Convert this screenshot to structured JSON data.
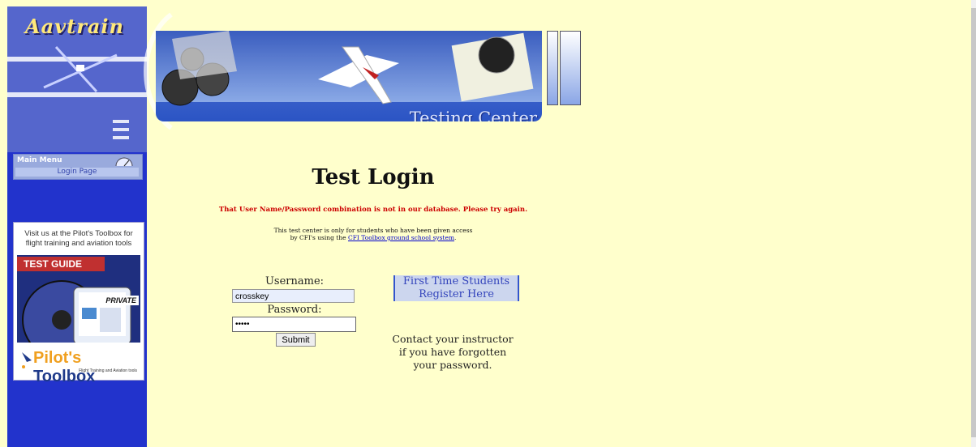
{
  "sidebar": {
    "logo_text": "Aavtrain",
    "menu_title": "Main Menu",
    "menu_item": "Login Page",
    "promo_text": "Visit us at the Pilot's Toolbox for flight training and aviation tools",
    "promo_cover": "TEST GUIDE",
    "promo_private": "PRIVATE",
    "toolbox_name_1": "Pilot's ",
    "toolbox_name_2": "Toolbox",
    "toolbox_tag": "Flight Training and Aviation tools"
  },
  "banner": {
    "title": "Testing Center"
  },
  "main": {
    "title": "Test Login",
    "error": "That User Name/Password combination is not in our database. Please try again.",
    "info_line1": "This test center is only for students who have been given access",
    "info_line2_prefix": "by CFI's using the ",
    "info_link": "CFI Toolbox ground school system",
    "info_line2_suffix": "."
  },
  "form": {
    "username_label": "Username:",
    "username_value": "crosskey",
    "password_label": "Password:",
    "password_value": "•••••",
    "submit_label": "Submit"
  },
  "register": {
    "line1": "First Time Students",
    "line2": "Register Here"
  },
  "contact": {
    "line1": "Contact your instructor",
    "line2": "if you have forgotten",
    "line3": "your password."
  },
  "colors": {
    "background": "#ffffcc",
    "sidebar": "#2233cc",
    "error": "#cc0000",
    "link": "#0000cc"
  }
}
